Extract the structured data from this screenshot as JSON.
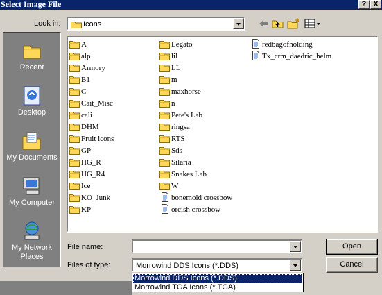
{
  "window": {
    "title": "Select Image File",
    "help_button": "?",
    "close_button": "X"
  },
  "toolbar": {
    "look_in_label": "Look in:",
    "look_in_value": "Icons",
    "icons": [
      "back-arrow-icon",
      "up-one-level-icon",
      "new-folder-icon",
      "view-menu-icon"
    ]
  },
  "places": [
    {
      "label": "Recent",
      "icon": "recent-icon"
    },
    {
      "label": "Desktop",
      "icon": "desktop-icon"
    },
    {
      "label": "My Documents",
      "icon": "my-documents-icon"
    },
    {
      "label": "My Computer",
      "icon": "my-computer-icon"
    },
    {
      "label": "My Network Places",
      "icon": "network-places-icon"
    }
  ],
  "files": {
    "column1": [
      {
        "name": "A",
        "type": "folder"
      },
      {
        "name": "alp",
        "type": "folder"
      },
      {
        "name": "Armory",
        "type": "folder"
      },
      {
        "name": "B1",
        "type": "folder"
      },
      {
        "name": "C",
        "type": "folder"
      },
      {
        "name": "Cait_Misc",
        "type": "folder"
      },
      {
        "name": "cali",
        "type": "folder"
      },
      {
        "name": "DHM",
        "type": "folder"
      },
      {
        "name": "Fruit icons",
        "type": "folder"
      },
      {
        "name": "GP",
        "type": "folder"
      },
      {
        "name": "HG_R",
        "type": "folder"
      },
      {
        "name": "HG_R4",
        "type": "folder"
      },
      {
        "name": "Ice",
        "type": "folder"
      },
      {
        "name": "KO_Junk",
        "type": "folder"
      },
      {
        "name": "KP",
        "type": "folder"
      }
    ],
    "column2": [
      {
        "name": "Legato",
        "type": "folder"
      },
      {
        "name": "lil",
        "type": "folder"
      },
      {
        "name": "LL",
        "type": "folder"
      },
      {
        "name": "m",
        "type": "folder"
      },
      {
        "name": "maxhorse",
        "type": "folder"
      },
      {
        "name": "n",
        "type": "folder"
      },
      {
        "name": "Pete's Lab",
        "type": "folder"
      },
      {
        "name": "ringsa",
        "type": "folder"
      },
      {
        "name": "RTS",
        "type": "folder"
      },
      {
        "name": "Sds",
        "type": "folder"
      },
      {
        "name": "Silaria",
        "type": "folder"
      },
      {
        "name": "Snakes Lab",
        "type": "folder"
      },
      {
        "name": "W",
        "type": "folder"
      },
      {
        "name": "bonemold crossbow",
        "type": "file"
      },
      {
        "name": "orcish crossbow",
        "type": "file"
      }
    ],
    "column3": [
      {
        "name": "redbagofholding",
        "type": "file"
      },
      {
        "name": "Tx_crm_daedric_helm",
        "type": "file"
      }
    ]
  },
  "filename": {
    "label": "File name:",
    "value": ""
  },
  "filetype": {
    "label": "Files of type:",
    "value": "Morrowind DDS Icons (*.DDS)",
    "options": [
      "Morrowind DDS Icons (*.DDS)",
      "Morrowind TGA Icons (*.TGA)"
    ],
    "selected_index": 0
  },
  "buttons": {
    "open": "Open",
    "cancel": "Cancel"
  },
  "colors": {
    "titlebar": "#0a246a",
    "selection": "#0a246a",
    "folder": "#ffd85a",
    "places_bg": "#808080"
  }
}
